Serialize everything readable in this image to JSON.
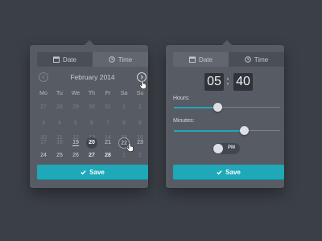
{
  "date_panel": {
    "tabs": [
      {
        "label": "Date",
        "icon": "calendar-icon",
        "active": true
      },
      {
        "label": "Time",
        "icon": "clock-icon",
        "active": false
      }
    ],
    "month_label": "February 2014",
    "weekdays": [
      "Mo",
      "Tu",
      "We",
      "Th",
      "Fr",
      "Sa",
      "Su"
    ],
    "weeks": [
      [
        "27",
        "28",
        "29",
        "30",
        "31",
        "1",
        "2"
      ],
      [
        "3",
        "4",
        "5",
        "6",
        "7",
        "8",
        "9"
      ],
      [
        "10",
        "11",
        "12",
        "13",
        "14",
        "15",
        "16"
      ],
      [
        "17",
        "18",
        "19",
        "20",
        "21",
        "22",
        "23"
      ],
      [
        "24",
        "25",
        "26",
        "27",
        "28",
        "1",
        "2"
      ]
    ],
    "save_label": "Save"
  },
  "time_panel": {
    "tabs": [
      {
        "label": "Date",
        "icon": "calendar-icon",
        "active": false
      },
      {
        "label": "Time",
        "icon": "clock-icon",
        "active": true
      }
    ],
    "hours": "05",
    "minutes": "40",
    "separator": ":",
    "hours_label": "Hours:",
    "minutes_label": "Minutes:",
    "hours_value": 0.41,
    "minutes_value": 0.66,
    "ampm_label": "PM",
    "save_label": "Save"
  },
  "colors": {
    "accent": "#1fa8b8",
    "background": "#3b4047",
    "panel": "#575c64"
  }
}
